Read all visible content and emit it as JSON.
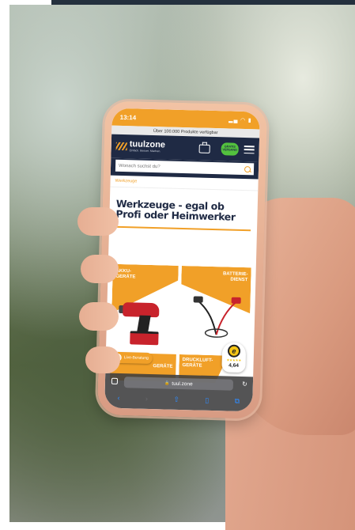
{
  "status_bar": {
    "time": "13:14"
  },
  "banner": {
    "text": "Über 100.000 Produkte verfügbar"
  },
  "header": {
    "logo_name": "tuulzone",
    "logo_tagline": "Einfach. Besser. Machen.",
    "badge_text": "GRATIS VERSAND"
  },
  "search": {
    "placeholder": "Wonach suchst du?"
  },
  "breadcrumb": {
    "current": "Werkzeuge"
  },
  "page": {
    "title": "Werkzeuge - egal ob Profi oder Heimwerker"
  },
  "categories": [
    {
      "label": "AKKU-\nGERÄTE"
    },
    {
      "label": "BATTERIE-\nDIENST"
    },
    {
      "label": "\nGERÄTE"
    },
    {
      "label": "DRUCKLUFT-\nGERÄTE"
    }
  ],
  "trust_badge": {
    "stars": "★★★★★",
    "score": "4,64"
  },
  "live_chat": {
    "label": "Live-Beratung"
  },
  "browser": {
    "url": "tuul.zone",
    "lock_icon": "lock-icon"
  },
  "colors": {
    "accent": "#f1a028",
    "navy": "#1f2a44",
    "badge_green": "#53c23e"
  }
}
